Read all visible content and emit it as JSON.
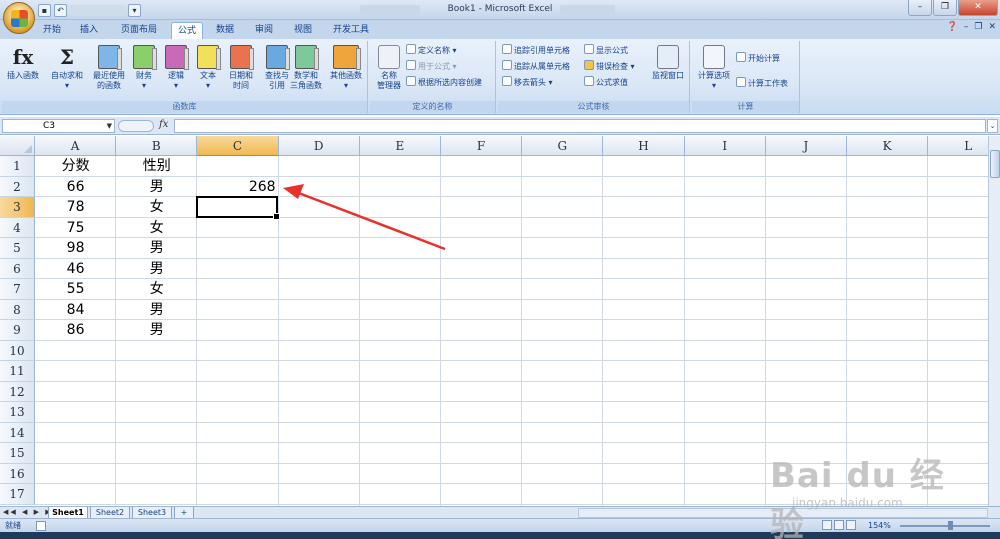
{
  "window": {
    "title": "Book1 - Microsoft Excel",
    "controls": [
      "–",
      "❐",
      "✕"
    ]
  },
  "quick_access": [
    "save-icon",
    "undo-icon",
    "redo-icon",
    "print-preview-icon"
  ],
  "tabs": [
    {
      "label": "开始",
      "active": false
    },
    {
      "label": "插入",
      "active": false
    },
    {
      "label": "页面布局",
      "active": false
    },
    {
      "label": "公式",
      "active": true
    },
    {
      "label": "数据",
      "active": false
    },
    {
      "label": "审阅",
      "active": false
    },
    {
      "label": "视图",
      "active": false
    },
    {
      "label": "开发工具",
      "active": false
    }
  ],
  "ribbon": {
    "function_library": {
      "group_label": "函数库",
      "insert_function": {
        "glyph": "fx",
        "label": "插入函数"
      },
      "autosum": {
        "glyph": "Σ",
        "label": "自动求和"
      },
      "recent": {
        "label1": "最近使用",
        "label2": "的函数"
      },
      "financial": {
        "label": "财务"
      },
      "logical": {
        "label": "逻辑"
      },
      "text": {
        "label": "文本"
      },
      "datetime": {
        "label1": "日期和",
        "label2": "时间"
      },
      "lookup": {
        "label1": "查找与",
        "label2": "引用"
      },
      "math": {
        "label1": "数学和",
        "label2": "三角函数"
      },
      "more": {
        "label": "其他函数"
      }
    },
    "defined_names": {
      "group_label": "定义的名称",
      "name_manager": {
        "label1": "名称",
        "label2": "管理器"
      },
      "define_name": "定义名称",
      "use_in_formula": "用于公式",
      "create_from_selection": "根据所选内容创建"
    },
    "formula_auditing": {
      "group_label": "公式审核",
      "trace_precedents": "追踪引用单元格",
      "trace_dependents": "追踪从属单元格",
      "remove_arrows": "移去箭头",
      "show_formulas": "显示公式",
      "error_checking": "错误检查",
      "evaluate_formula": "公式求值",
      "watch_window": "监视窗口"
    },
    "calculation": {
      "group_label": "计算",
      "options": "计算选项",
      "calc_now": "开始计算",
      "calc_sheet": "计算工作表"
    }
  },
  "formula_bar": {
    "name_box": "C3",
    "fx": "fx",
    "content": ""
  },
  "grid": {
    "columns": [
      "A",
      "B",
      "C",
      "D",
      "E",
      "F",
      "G",
      "H",
      "I",
      "J",
      "K",
      "L"
    ],
    "rows": [
      "1",
      "2",
      "3",
      "4",
      "5",
      "6",
      "7",
      "8",
      "9",
      "10",
      "11",
      "12",
      "13",
      "14",
      "15",
      "16",
      "17"
    ],
    "selected_cell": "C3",
    "cells": {
      "A": [
        "分数",
        "66",
        "78",
        "75",
        "98",
        "46",
        "55",
        "84",
        "86"
      ],
      "B": [
        "性别",
        "男",
        "女",
        "女",
        "男",
        "男",
        "女",
        "男",
        "男"
      ],
      "C2": "268"
    }
  },
  "sheets": [
    {
      "label": "Sheet1",
      "active": true
    },
    {
      "label": "Sheet2",
      "active": false
    },
    {
      "label": "Sheet3",
      "active": false
    }
  ],
  "status": {
    "ready": "就绪",
    "zoom": "154%"
  },
  "watermark": {
    "mark": "Bai du 经验",
    "url": "jingyan.baidu.com"
  },
  "colors": {
    "accent": "#f1b84f",
    "ribbon": "#dbe7f6",
    "arrow": "#e8312a"
  }
}
